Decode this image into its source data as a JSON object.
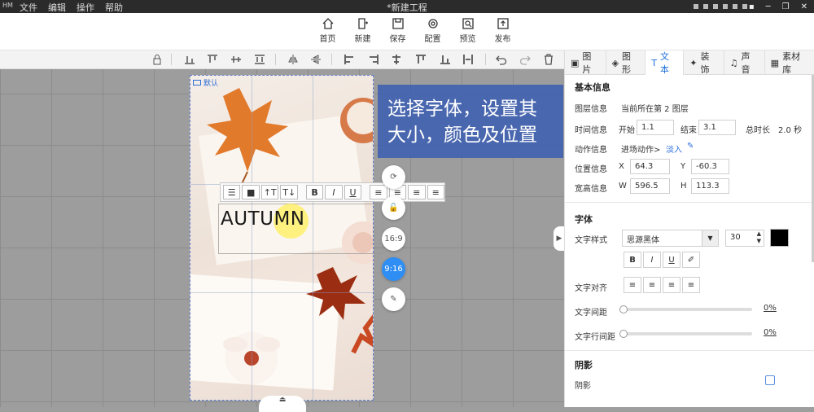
{
  "titlebar": {
    "logo": "HM",
    "menu": [
      "文件",
      "编辑",
      "操作",
      "帮助"
    ],
    "title": "*新建工程",
    "controls": [
      "▪",
      "─",
      "❐",
      "✕"
    ]
  },
  "toolbar": {
    "items": [
      {
        "label": "首页",
        "icon": "home-icon"
      },
      {
        "label": "新建",
        "icon": "new-icon"
      },
      {
        "label": "保存",
        "icon": "save-icon"
      },
      {
        "label": "配置",
        "icon": "settings-icon"
      },
      {
        "label": "预览",
        "icon": "preview-icon"
      },
      {
        "label": "发布",
        "icon": "publish-icon"
      }
    ]
  },
  "canvas": {
    "default_tag": "默认",
    "text_content": "AUTUMN",
    "format_buttons": [
      "☰",
      "■",
      "↑T",
      "T↓",
      "B",
      "I",
      "U",
      "≡",
      "≡",
      "≡",
      "≡"
    ],
    "tooltip_line1": "选择字体，设置其",
    "tooltip_line2": "大小，颜色及位置",
    "side_buttons": [
      "⟳",
      "🔓",
      "16:9",
      "9:16",
      "✎"
    ],
    "bottom_handle": "⏏"
  },
  "panel": {
    "tabs": [
      {
        "label": "图片",
        "icon": "▣"
      },
      {
        "label": "图形",
        "icon": "◈"
      },
      {
        "label": "文本",
        "icon": "T"
      },
      {
        "label": "装饰",
        "icon": "✦"
      },
      {
        "label": "声音",
        "icon": "♫"
      },
      {
        "label": "素材库",
        "icon": "▦"
      }
    ],
    "basic_title": "基本信息",
    "layer_label": "图层信息",
    "layer_value": "当前所在第 2 图层",
    "time_label": "时间信息",
    "start_label": "开始",
    "start_value": "1.1",
    "end_label": "结束",
    "end_value": "3.1",
    "duration_label": "总时长",
    "duration_value": "2.0 秒",
    "action_label": "动作信息",
    "action_value": "进场动作>",
    "action_link": "淡入",
    "pos_label": "位置信息",
    "x_label": "X",
    "x_value": "64.3",
    "y_label": "Y",
    "y_value": "-60.3",
    "size_label": "宽高信息",
    "w_label": "W",
    "w_value": "596.5",
    "h_label": "H",
    "h_value": "113.3",
    "font_title": "字体",
    "font_style_label": "文字样式",
    "font_name": "思源黑体",
    "font_size": "30",
    "style_buttons": [
      "B",
      "I",
      "U",
      "✐"
    ],
    "align_label": "文字对齐",
    "align_buttons": [
      "≡",
      "≡",
      "≡",
      "≡"
    ],
    "spacing_label": "文字间距",
    "spacing_value": "0%",
    "line_spacing_label": "文字行间距",
    "line_spacing_value": "0%",
    "shadow_title": "阴影",
    "shadow_label": "阴影",
    "text_color": "#000000"
  }
}
